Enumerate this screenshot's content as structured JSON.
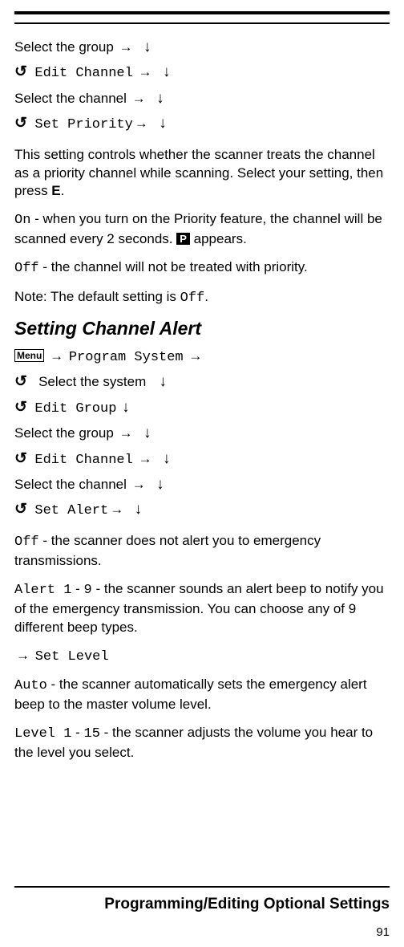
{
  "glyph": {
    "right": "→",
    "down": "↓",
    "refresh": "↺",
    "menu": "Menu",
    "p_badge": "P"
  },
  "nav1": {
    "line1_a": "Select the group",
    "line2_a": "Edit Channel",
    "line3_a": "Select the channel",
    "line4_a": "Set Priority"
  },
  "para1": {
    "a": "This setting controls whether the scanner treats the channel as a priority channel while scanning. Select your setting, then press ",
    "e": "E",
    "b": "."
  },
  "para2": {
    "on": "On",
    "a": " - when you turn on the Priority feature, the channel will be scanned every 2 seconds. ",
    "b": " appears."
  },
  "para3": {
    "off": "Off",
    "a": " - the channel will not be treated with priority."
  },
  "para4": {
    "a": "Note: The default setting is ",
    "off": "Off",
    "b": "."
  },
  "section2": "Setting Channel Alert",
  "nav2": {
    "line1_a": "Program System",
    "line2_a": "Select the system",
    "line3_a": "Edit Group",
    "line4_a": "Select the group",
    "line5_a": "Edit Channel",
    "line6_a": "Select the channel",
    "line7_a": "Set Alert"
  },
  "para5": {
    "off": "Off",
    "a": " - the scanner does not alert you to emergency transmissions."
  },
  "para6": {
    "a1": "Alert 1",
    "dash": " - ",
    "a9": "9",
    "b": " - the scanner sounds an alert beep to notify you of the emergency transmission. You can choose any of 9 different beep types."
  },
  "para7": {
    "a": "Set Level"
  },
  "para8": {
    "auto": "Auto",
    "a": " - the scanner automatically sets the emergency alert beep to the master volume level."
  },
  "para9": {
    "l1": "Level 1",
    "dash": " - ",
    "l15": "15",
    "a": " - the scanner adjusts the volume you hear to the level you select."
  },
  "footer": {
    "title": "Programming/Editing Optional Settings",
    "page": "91"
  }
}
